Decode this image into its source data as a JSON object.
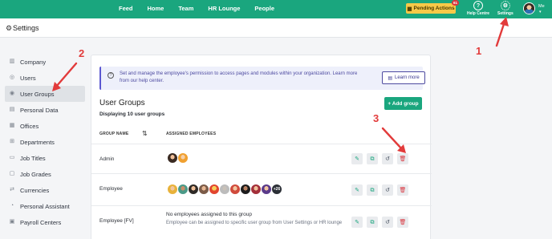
{
  "topnav": {
    "links": [
      "Feed",
      "Home",
      "Team",
      "HR Lounge",
      "People"
    ],
    "pending_label": "Pending Actions",
    "pending_count": "61",
    "help_label": "Help Centre",
    "settings_label": "Settings",
    "me_label": "Me"
  },
  "header": {
    "title": "Settings"
  },
  "sidebar": {
    "items": [
      {
        "label": "Company",
        "icon": "building-icon"
      },
      {
        "label": "Users",
        "icon": "users-icon"
      },
      {
        "label": "User Groups",
        "icon": "user-groups-icon",
        "active": true
      },
      {
        "label": "Personal Data",
        "icon": "id-card-icon"
      },
      {
        "label": "Offices",
        "icon": "office-icon"
      },
      {
        "label": "Departments",
        "icon": "departments-icon"
      },
      {
        "label": "Job Titles",
        "icon": "briefcase-icon"
      },
      {
        "label": "Job Grades",
        "icon": "grades-icon"
      },
      {
        "label": "Currencies",
        "icon": "currency-icon"
      },
      {
        "label": "Personal Assistant",
        "icon": "assistant-icon"
      },
      {
        "label": "Payroll Centers",
        "icon": "payroll-icon"
      }
    ]
  },
  "info": {
    "text": "Set and manage the employee's permission to access pages and modules within your organization. Learn more from our help center.",
    "learn_more": "Learn more"
  },
  "main": {
    "title": "User Groups",
    "subtitle": "Displaying 10 user groups",
    "add_group": "+ Add group",
    "col_name": "GROUP NAME",
    "col_employees": "ASSIGNED EMPLOYEES"
  },
  "rows": [
    {
      "name": "Admin",
      "avatar_count": 2
    },
    {
      "name": "Employee",
      "avatar_count": 10,
      "more": "+26"
    },
    {
      "name": "Employee [FV]",
      "empty_title": "No employees assigned to this group",
      "empty_desc": "Employee can be assigned to specific user group from User Settings or HR lounge"
    }
  ],
  "annotations": [
    "1",
    "2",
    "3"
  ],
  "colors": {
    "brand": "#1aa67e",
    "pending": "#f7c948",
    "annotation": "#e23b3b",
    "info_accent": "#5b57d1"
  }
}
